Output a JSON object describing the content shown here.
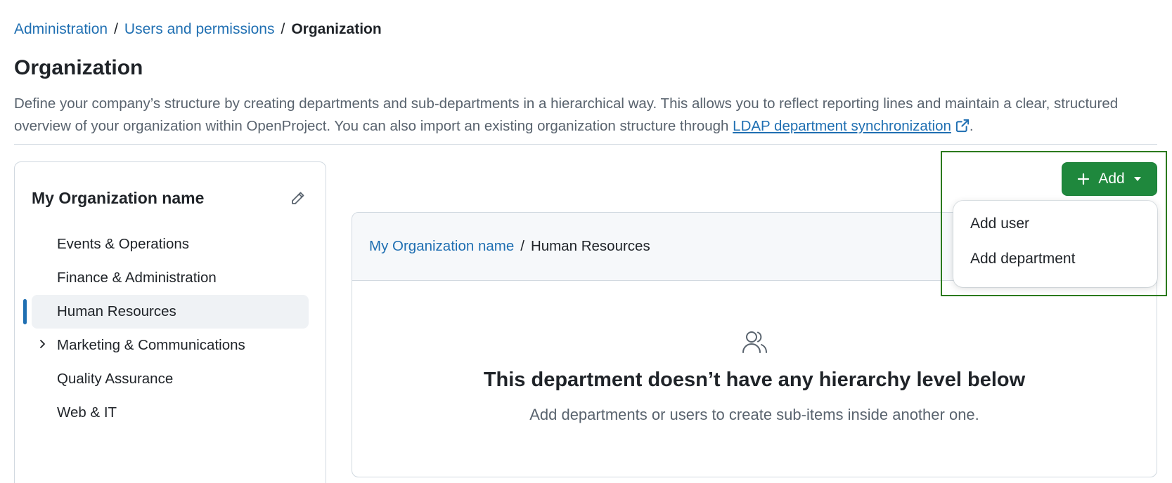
{
  "breadcrumb": {
    "items": [
      "Administration",
      "Users and permissions"
    ],
    "current": "Organization",
    "separator": "/"
  },
  "page": {
    "title": "Organization",
    "description_before_link": "Define your company’s structure by creating departments and sub-departments in a hierarchical way. This allows you to reflect reporting lines and maintain a clear, structured overview of your organization within OpenProject. You can also import an existing organization structure through ",
    "link_text": "LDAP department synchronization",
    "description_after_link": "."
  },
  "sidebar": {
    "org_name": "My Organization name",
    "items": [
      {
        "label": "Events & Operations"
      },
      {
        "label": "Finance & Administration"
      },
      {
        "label": "Human Resources"
      },
      {
        "label": "Marketing & Communications"
      },
      {
        "label": "Quality Assurance"
      },
      {
        "label": "Web & IT"
      }
    ]
  },
  "main": {
    "breadcrumb_root": "My Organization name",
    "breadcrumb_separator": "/",
    "breadcrumb_current": "Human Resources",
    "blank_title": "This department doesn’t have any hierarchy level below",
    "blank_description": "Add departments or users to create sub-items inside another one."
  },
  "add_button": {
    "label": "Add"
  },
  "menu": {
    "items": [
      "Add user",
      "Add department"
    ]
  },
  "colors": {
    "link": "#1f6fb2",
    "primary_button": "#1f883d",
    "active_indicator": "#1f6fb2",
    "highlight_frame": "#2b7a1d"
  },
  "icons": {
    "edit": "pencil-icon",
    "external": "external-link-icon",
    "expand": "chevron-right-icon",
    "blank": "people-icon",
    "plus": "plus-icon",
    "dropdown": "triangle-down-icon"
  }
}
